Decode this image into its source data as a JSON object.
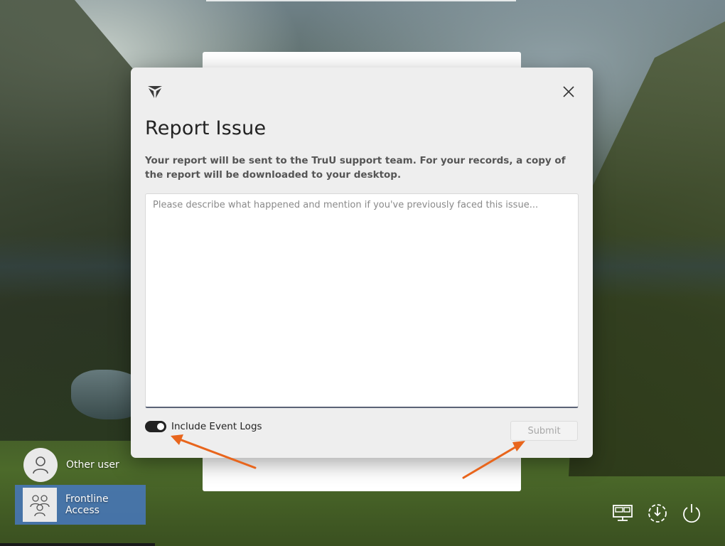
{
  "dialog": {
    "title": "Report Issue",
    "description": "Your report will be sent to the TruU support team. For your records, a copy of the report will be downloaded to your desktop.",
    "textarea_placeholder": "Please describe what happened and mention if you've previously faced this issue...",
    "textarea_value": "",
    "toggle_label": "Include Event Logs",
    "toggle_on": true,
    "submit_label": "Submit"
  },
  "users": [
    {
      "name": "Other user"
    },
    {
      "name": "Frontline Access"
    }
  ],
  "colors": {
    "accent_arrow": "#e8651c",
    "selected_tile": "#4878be"
  },
  "icons": [
    "truu-logo-icon",
    "close-icon",
    "user-icon",
    "group-users-icon",
    "network-icon",
    "accessibility-icon",
    "power-icon"
  ]
}
